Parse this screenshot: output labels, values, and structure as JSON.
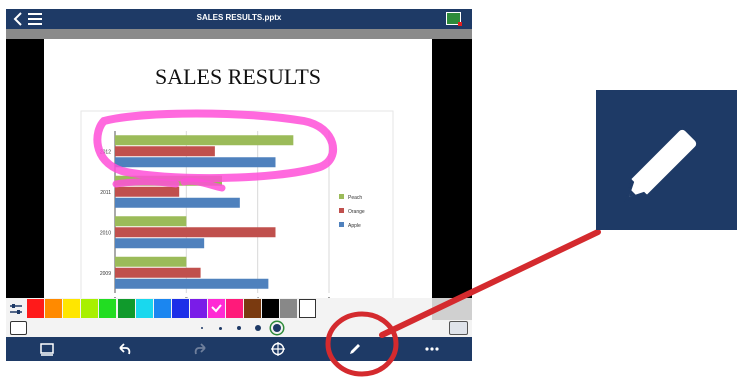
{
  "app": {
    "title": "SALES RESULTS.pptx"
  },
  "slide": {
    "title": "SALES RESULTS"
  },
  "chart_data": {
    "type": "bar",
    "orientation": "horizontal",
    "categories": [
      "2009",
      "2010",
      "2011",
      "2012"
    ],
    "series": [
      {
        "name": "Peach",
        "color": "#9bbb59",
        "values": [
          2,
          2,
          3,
          5
        ]
      },
      {
        "name": "Orange",
        "color": "#c0504d",
        "values": [
          2.4,
          4.5,
          1.8,
          2.8
        ]
      },
      {
        "name": "Apple",
        "color": "#4f81bd",
        "values": [
          4.3,
          2.5,
          3.5,
          4.5
        ]
      }
    ],
    "xlim": [
      0,
      6
    ],
    "xticks": [
      "0",
      "2",
      "4",
      "6"
    ],
    "grid": true,
    "legend": "right"
  },
  "palette": {
    "colors": [
      "#ff1a1a",
      "#ff8a00",
      "#ffe600",
      "#a8f000",
      "#22dd22",
      "#109a2c",
      "#19d8ee",
      "#1b86f0",
      "#1c2fe8",
      "#7a1ce8",
      "#ff2ad4",
      "#ff1a7a",
      "#7a3a10",
      "#000000",
      "#888888",
      "#ffffff"
    ],
    "selected_index": 10
  },
  "pen_sizes": {
    "count": 5,
    "selected_index": 4
  },
  "toolbar": {
    "icons": [
      "slides-icon",
      "undo-icon",
      "redo-icon",
      "pointer-icon",
      "pen-icon",
      "more-icon"
    ]
  },
  "annotation": {
    "color": "#ff4fd8"
  },
  "callout": {
    "icon": "pen-icon",
    "marker_color": "#d42a2e"
  }
}
